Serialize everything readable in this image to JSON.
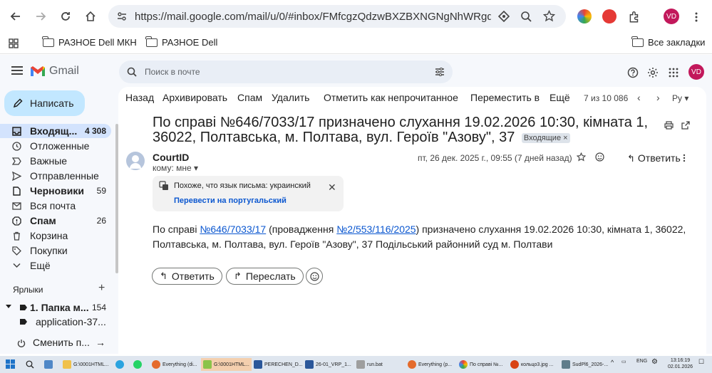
{
  "browser": {
    "url": "https://mail.google.com/mail/u/0/#inbox/FMfcgzQdzwBXZBXNGNgNhWRgdBgz...",
    "profile_initials": "VD"
  },
  "bookmarks": {
    "items": [
      "РАЗНОЕ Dell МКН",
      "РАЗНОЕ Dell"
    ],
    "all_bookmarks": "Все закладки"
  },
  "gmail": {
    "logo_text": "Gmail",
    "search_placeholder": "Поиск в почте",
    "avatar_initials": "VD",
    "compose_label": "Написать"
  },
  "sidebar": {
    "items": [
      {
        "label": "Входящ...",
        "count": "4 308"
      },
      {
        "label": "Отложенные",
        "count": ""
      },
      {
        "label": "Важные",
        "count": ""
      },
      {
        "label": "Отправленные",
        "count": ""
      },
      {
        "label": "Черновики",
        "count": "59"
      },
      {
        "label": "Вся почта",
        "count": ""
      },
      {
        "label": "Спам",
        "count": "26"
      },
      {
        "label": "Корзина",
        "count": ""
      },
      {
        "label": "Покупки",
        "count": ""
      },
      {
        "label": "Ещё",
        "count": ""
      }
    ],
    "labels_header": "Ярлыки",
    "labels": [
      {
        "label": "1. Папка м...",
        "count": "154"
      },
      {
        "label": "application-37...",
        "count": ""
      }
    ],
    "switch_label": "Сменить п..."
  },
  "toolbar": {
    "back": "Назад",
    "archive": "Архивировать",
    "spam": "Спам",
    "delete": "Удалить",
    "mark_unread": "Отметить как непрочитанное",
    "move_to": "Переместить в",
    "more": "Ещё",
    "pagination": "7 из 10 086",
    "lang": "Ру"
  },
  "message": {
    "subject": "По справі №646/7033/17 призначено слухання 19.02.2026 10:30, кімната 1, 36022, Полтавська, м. Полтава, вул. Героїв \"Азову\", 37",
    "inbox_tag": "Входящие",
    "sender": "CourtID",
    "to": "кому: мне",
    "date": "пт, 26 дек. 2025 г., 09:55 (7 дней назад)",
    "reply_label": "Ответить",
    "lang_notice": "Похоже, что язык письма: украинский",
    "translate_link": "Перевести на португальский",
    "body_1": "По справі ",
    "body_link_1": "№646/7033/17",
    "body_2": " (провадження ",
    "body_link_2": "№2/553/116/2025",
    "body_3": ") призначено слухання 19.02.2026 10:30, кімната 1, 36022, Полтавська, м. Полтава, вул. Героїв \"Азову\", 37 Подільський районний суд м. Полтави",
    "reply_button": "Ответить",
    "forward_button": "Переслать"
  },
  "taskbar": {
    "items": [
      "G:\\0001HTML...",
      "Everything (di...",
      "G:\\0001HTML...",
      "PERECHEN_D...",
      "26-01_VRP_1...",
      "run.bat",
      "Everything (p...",
      "По справі №...",
      "кольцо3.jpg ...",
      "SudPl6_2026-..."
    ],
    "lang": "ENG",
    "time": "13:16:19",
    "date": "02.01.2026"
  }
}
